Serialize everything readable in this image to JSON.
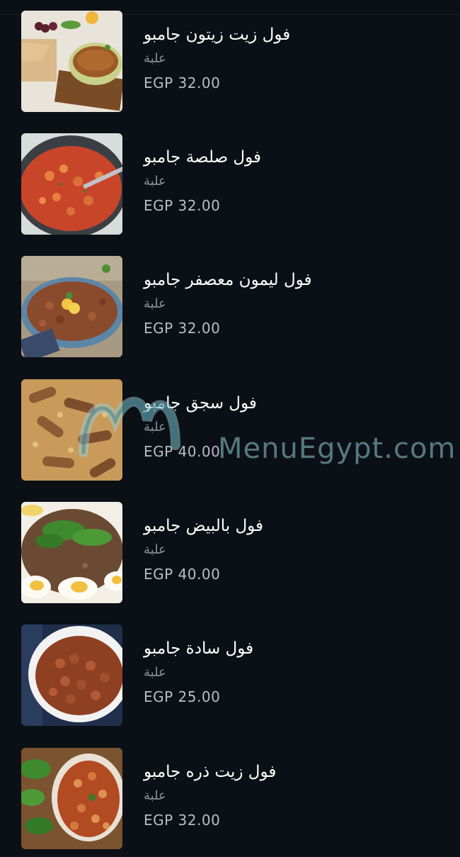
{
  "menu": {
    "items": [
      {
        "name": "فول زيت زيتون جامبو",
        "unit": "علبة",
        "price": "EGP 32.00"
      },
      {
        "name": "فول صلصة جامبو",
        "unit": "علبة",
        "price": "EGP 32.00"
      },
      {
        "name": "فول ليمون معصفر جامبو",
        "unit": "علبة",
        "price": "EGP 32.00"
      },
      {
        "name": "فول سجق جامبو",
        "unit": "علبة",
        "price": "EGP 40.00"
      },
      {
        "name": "فول بالبيض جامبو",
        "unit": "علبة",
        "price": "EGP 40.00"
      },
      {
        "name": "فول سادة جامبو",
        "unit": "علبة",
        "price": "EGP 25.00"
      },
      {
        "name": "فول زيت ذره جامبو",
        "unit": "علبة",
        "price": "EGP 32.00"
      }
    ]
  },
  "watermark": {
    "text": "MenuEgypt.com"
  },
  "colors": {
    "background": "#0b1016",
    "name_text": "#ffffff",
    "unit_text": "#8a929b",
    "price_text": "#b9bec4"
  }
}
